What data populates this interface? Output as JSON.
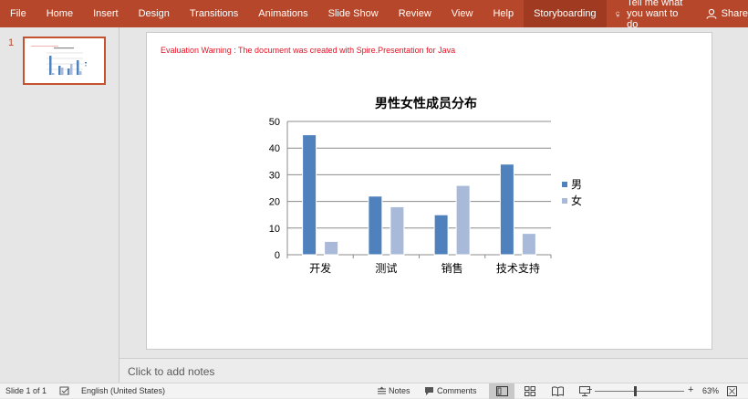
{
  "ribbon": {
    "tabs": [
      "File",
      "Home",
      "Insert",
      "Design",
      "Transitions",
      "Animations",
      "Slide Show",
      "Review",
      "View",
      "Help",
      "Storyboarding"
    ],
    "active_tab": "Storyboarding",
    "tell_me": "Tell me what you want to do",
    "share": "Share"
  },
  "thumbnails": {
    "slide_number": "1"
  },
  "slide": {
    "warning": "Evaluation Warning : The document was created with  Spire.Presentation for Java"
  },
  "chart_data": {
    "type": "bar",
    "title": "男性女性成员分布",
    "categories": [
      "开发",
      "测试",
      "销售",
      "技术支持"
    ],
    "series": [
      {
        "name": "男",
        "values": [
          45,
          22,
          15,
          34
        ],
        "color": "#4f81bd"
      },
      {
        "name": "女",
        "values": [
          5,
          18,
          26,
          8
        ],
        "color": "#a9b9d9"
      }
    ],
    "ylim": [
      0,
      50
    ],
    "yticks": [
      0,
      10,
      20,
      30,
      40,
      50
    ],
    "grid": true,
    "legend": "right"
  },
  "notes": {
    "placeholder": "Click to add notes"
  },
  "status": {
    "slide_info": "Slide 1 of 1",
    "language": "English (United States)",
    "notes_label": "Notes",
    "comments_label": "Comments",
    "zoom": "63%"
  }
}
